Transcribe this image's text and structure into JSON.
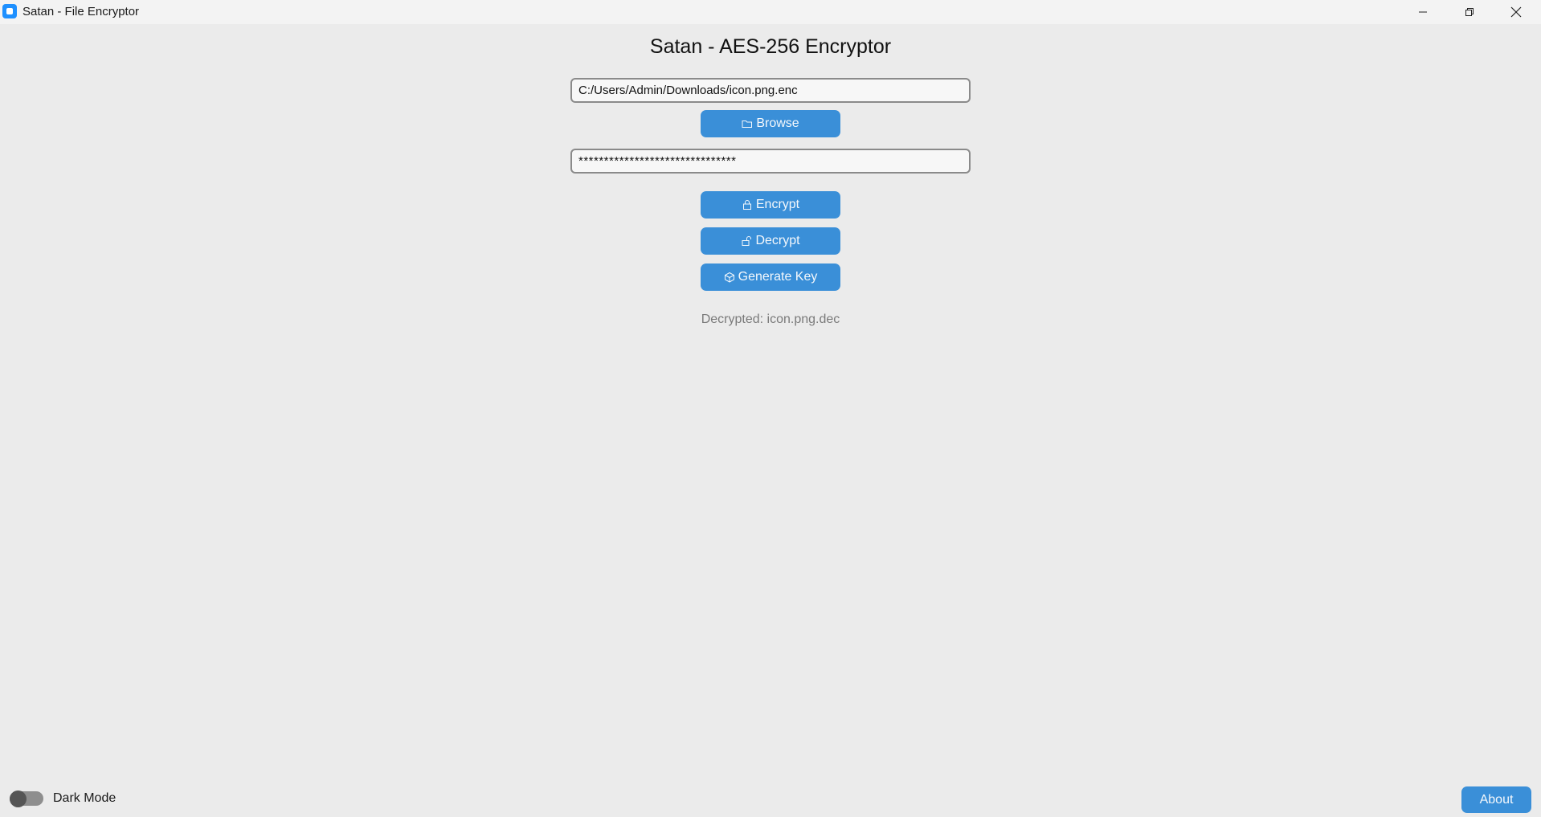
{
  "window": {
    "title": "Satan - File Encryptor"
  },
  "app": {
    "heading": "Satan - AES-256 Encryptor",
    "file_path_value": "C:/Users/Admin/Downloads/icon.png.enc",
    "key_value": "*******************************",
    "buttons": {
      "browse": {
        "label": "Browse",
        "icon": "folder-icon"
      },
      "encrypt": {
        "label": "Encrypt",
        "icon": "lock-icon"
      },
      "decrypt": {
        "label": "Decrypt",
        "icon": "unlock-icon"
      },
      "generate_key": {
        "label": "Generate Key",
        "icon": "cube-icon"
      }
    },
    "status": "Decrypted: icon.png.dec"
  },
  "footer": {
    "dark_mode_label": "Dark Mode",
    "dark_mode_on": false,
    "about_label": "About"
  },
  "colors": {
    "accent": "#3a8fd8",
    "background": "#ebebeb"
  }
}
